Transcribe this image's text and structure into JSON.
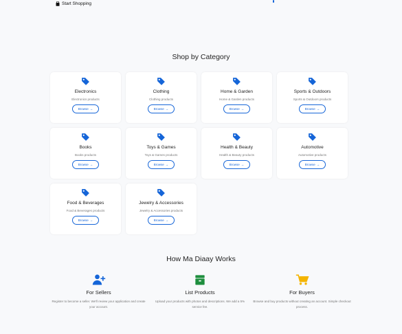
{
  "header": {
    "start_shopping_label": "Start Shopping"
  },
  "categories_section": {
    "title": "Shop by Category",
    "browse_label": "Browse",
    "items": [
      {
        "name": "Electronics",
        "description": "Electronics products"
      },
      {
        "name": "Clothing",
        "description": "Clothing products"
      },
      {
        "name": "Home & Garden",
        "description": "Home & Garden products"
      },
      {
        "name": "Sports & Outdoors",
        "description": "Sports & Outdoors products"
      },
      {
        "name": "Books",
        "description": "Books products"
      },
      {
        "name": "Toys & Games",
        "description": "Toys & Games products"
      },
      {
        "name": "Health & Beauty",
        "description": "Health & Beauty products"
      },
      {
        "name": "Automotive",
        "description": "Automotive products"
      },
      {
        "name": "Food & Beverages",
        "description": "Food & Beverages products"
      },
      {
        "name": "Jewelry & Accessories",
        "description": "Jewelry & Accessories products"
      }
    ]
  },
  "how_section": {
    "title": "How Ma Diaay Works",
    "items": [
      {
        "title": "For Sellers",
        "description": "Register to become a seller. We'll review your application and create your account.",
        "icon": "add-user-icon",
        "color": "#1565d8"
      },
      {
        "title": "List Products",
        "description": "Upload your products with photos and descriptions. We add a 5% service fee.",
        "icon": "store-icon",
        "color": "#1e8e3e"
      },
      {
        "title": "For Buyers",
        "description": "Browse and buy products without creating an account. Simple checkout process.",
        "icon": "shopping-cart-icon",
        "color": "#f4b400"
      }
    ]
  },
  "colors": {
    "accent": "#1565d8",
    "background": "#f8f9fb"
  }
}
